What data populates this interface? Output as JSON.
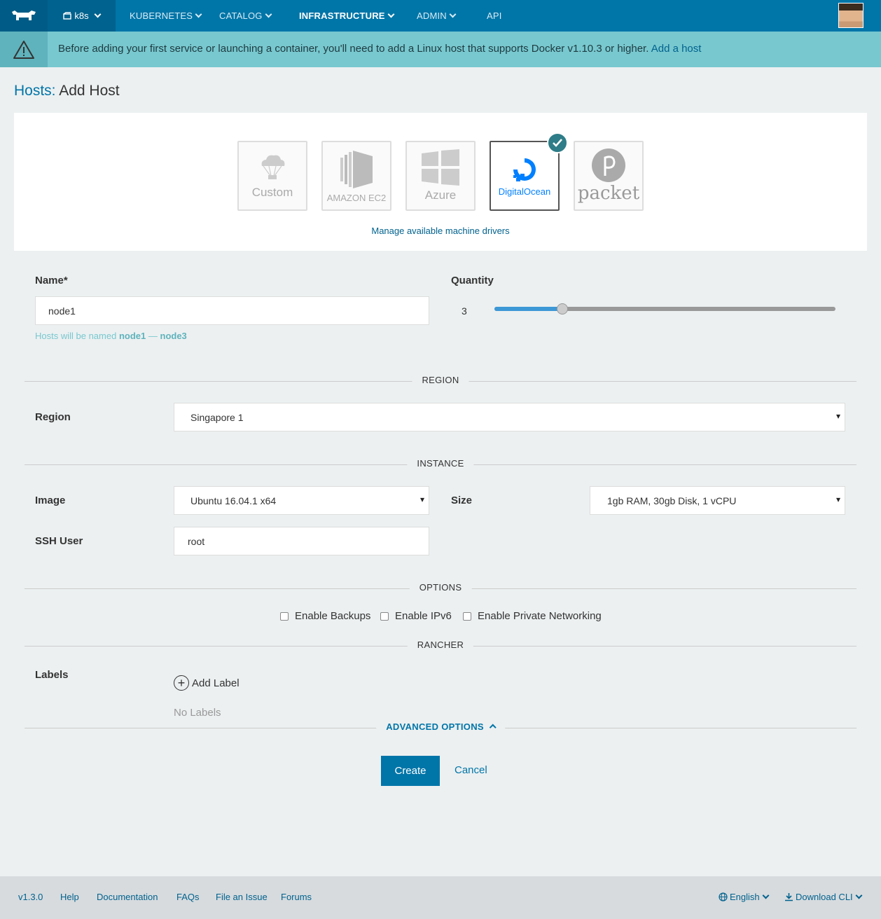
{
  "nav": {
    "environment": "k8s",
    "items": [
      "KUBERNETES",
      "CATALOG",
      "INFRASTRUCTURE",
      "ADMIN",
      "API"
    ]
  },
  "banner": {
    "message": "Before adding your first service or launching a container, you'll need to add a Linux host that supports Docker v1.10.3 or higher.",
    "link": "Add a host"
  },
  "page": {
    "title_prefix": "Hosts:",
    "title": "Add Host"
  },
  "drivers": {
    "items": [
      {
        "label": "Custom",
        "icon": "cloud-parachute-icon"
      },
      {
        "label": "AMAZON EC2",
        "icon": "amazon-ec2-icon"
      },
      {
        "label": "Azure",
        "icon": "windows-icon"
      },
      {
        "label": "DigitalOcean",
        "icon": "digitalocean-icon",
        "selected": true
      },
      {
        "label": "packet",
        "icon": "packet-icon"
      }
    ],
    "manage_link": "Manage available machine drivers"
  },
  "form": {
    "name_label": "Name*",
    "name_value": "node1",
    "quantity_label": "Quantity",
    "quantity_value": "3",
    "quantity_fraction": 0.2,
    "hint_prefix": "Hosts will be named",
    "hint_first": "node1",
    "hint_sep": "—",
    "hint_last": "node3"
  },
  "sections": {
    "region": "REGION",
    "instance": "INSTANCE",
    "options": "OPTIONS",
    "rancher": "RANCHER",
    "advanced": "ADVANCED OPTIONS"
  },
  "region": {
    "label": "Region",
    "value": "Singapore 1"
  },
  "instance": {
    "image_label": "Image",
    "image_value": "Ubuntu 16.04.1 x64",
    "size_label": "Size",
    "size_value": "1gb RAM, 30gb Disk, 1 vCPU",
    "ssh_label": "SSH User",
    "ssh_value": "root"
  },
  "options": {
    "backups": "Enable Backups",
    "ipv6": "Enable IPv6",
    "private_net": "Enable Private Networking"
  },
  "labels": {
    "label": "Labels",
    "add": "Add Label",
    "empty": "No Labels"
  },
  "actions": {
    "create": "Create",
    "cancel": "Cancel"
  },
  "footer": {
    "version": "v1.3.0",
    "help": "Help",
    "docs": "Documentation",
    "faqs": "FAQs",
    "issue": "File an Issue",
    "forums": "Forums",
    "language": "English",
    "download": "Download CLI"
  },
  "colors": {
    "nav": "#0075a8",
    "banner": "#78c8cf",
    "accent": "#0075a8",
    "selected_badge": "#2e7d88"
  }
}
